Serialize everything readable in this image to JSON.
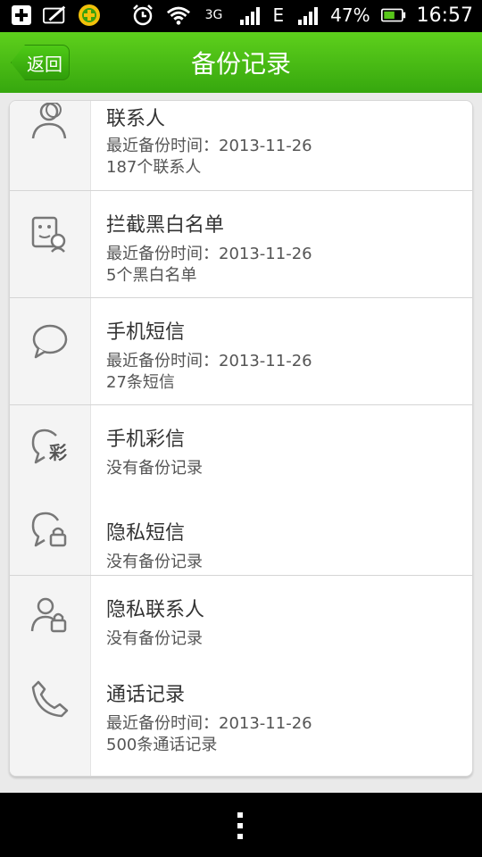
{
  "status": {
    "battery": "47%",
    "time": "16:57",
    "network_3g": "3G",
    "network_e": "E"
  },
  "header": {
    "back_label": "返回",
    "title": "备份记录"
  },
  "items": [
    {
      "title": "联系人",
      "line1": "最近备份时间：2013-11-26",
      "line2": "187个联系人",
      "icon": "contacts-icon"
    },
    {
      "title": "拦截黑白名单",
      "line1": "最近备份时间：2013-11-26",
      "line2": "5个黑白名单",
      "icon": "blocklist-icon"
    },
    {
      "title": "手机短信",
      "line1": "最近备份时间：2013-11-26",
      "line2": "27条短信",
      "icon": "sms-icon"
    },
    {
      "title": "手机彩信",
      "line1": "没有备份记录",
      "icon": "mms-icon",
      "icon_char": "彩"
    },
    {
      "title": "隐私短信",
      "line1": "没有备份记录",
      "icon": "private-sms-icon"
    },
    {
      "title": "隐私联系人",
      "line1": "没有备份记录",
      "icon": "private-contacts-icon"
    },
    {
      "title": "通话记录",
      "line1": "最近备份时间：2013-11-26",
      "line2": "500条通话记录",
      "icon": "call-log-icon"
    }
  ]
}
